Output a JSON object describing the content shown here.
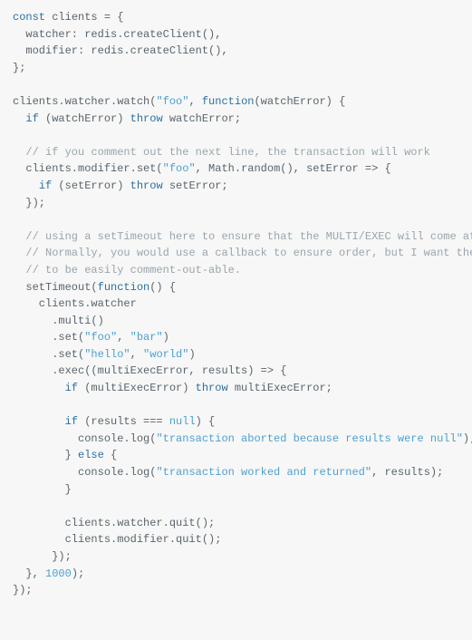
{
  "code": {
    "l01": {
      "kw1": "const",
      "id": " clients = {"
    },
    "l02": {
      "id": "  watcher: redis.createClient(),"
    },
    "l03": {
      "id": "  modifier: redis.createClient(),"
    },
    "l04": {
      "id": "};"
    },
    "l05": {
      "id": ""
    },
    "l06": {
      "a": "clients.watcher.watch(",
      "s": "\"foo\"",
      "b": ", ",
      "kw": "function",
      "c": "(watchError) {"
    },
    "l07": {
      "a": "  ",
      "kw": "if",
      "b": " (watchError) ",
      "kw2": "throw",
      "c": " watchError;"
    },
    "l08": {
      "id": ""
    },
    "l09": {
      "com": "  // if you comment out the next line, the transaction will work"
    },
    "l10": {
      "a": "  clients.modifier.set(",
      "s": "\"foo\"",
      "b": ", Math.random(), setError => {"
    },
    "l11": {
      "a": "    ",
      "kw": "if",
      "b": " (setError) ",
      "kw2": "throw",
      "c": " setError;"
    },
    "l12": {
      "id": "  });"
    },
    "l13": {
      "id": ""
    },
    "l14": {
      "com": "  // using a setTimeout here to ensure that the MULTI/EXEC will come after the SET."
    },
    "l15": {
      "com": "  // Normally, you would use a callback to ensure order, but I want the above SET command"
    },
    "l16": {
      "com": "  // to be easily comment-out-able."
    },
    "l17": {
      "a": "  setTimeout(",
      "kw": "function",
      "b": "() {"
    },
    "l18": {
      "id": "    clients.watcher"
    },
    "l19": {
      "id": "      .multi()"
    },
    "l20": {
      "a": "      .set(",
      "s1": "\"foo\"",
      "b": ", ",
      "s2": "\"bar\"",
      "c": ")"
    },
    "l21": {
      "a": "      .set(",
      "s1": "\"hello\"",
      "b": ", ",
      "s2": "\"world\"",
      "c": ")"
    },
    "l22": {
      "id": "      .exec((multiExecError, results) => {"
    },
    "l23": {
      "a": "        ",
      "kw": "if",
      "b": " (multiExecError) ",
      "kw2": "throw",
      "c": " multiExecError;"
    },
    "l24": {
      "id": ""
    },
    "l25": {
      "a": "        ",
      "kw": "if",
      "b": " (results === ",
      "n": "null",
      "c": ") {"
    },
    "l26": {
      "a": "          console.log(",
      "s": "\"transaction aborted because results were null\"",
      "b": ");"
    },
    "l27": {
      "a": "        } ",
      "kw": "else",
      "b": " {"
    },
    "l28": {
      "a": "          console.log(",
      "s": "\"transaction worked and returned\"",
      "b": ", results);"
    },
    "l29": {
      "id": "        }"
    },
    "l30": {
      "id": ""
    },
    "l31": {
      "id": "        clients.watcher.quit();"
    },
    "l32": {
      "id": "        clients.modifier.quit();"
    },
    "l33": {
      "id": "      });"
    },
    "l34": {
      "a": "  }, ",
      "n": "1000",
      "b": ");"
    },
    "l35": {
      "id": "});"
    }
  }
}
